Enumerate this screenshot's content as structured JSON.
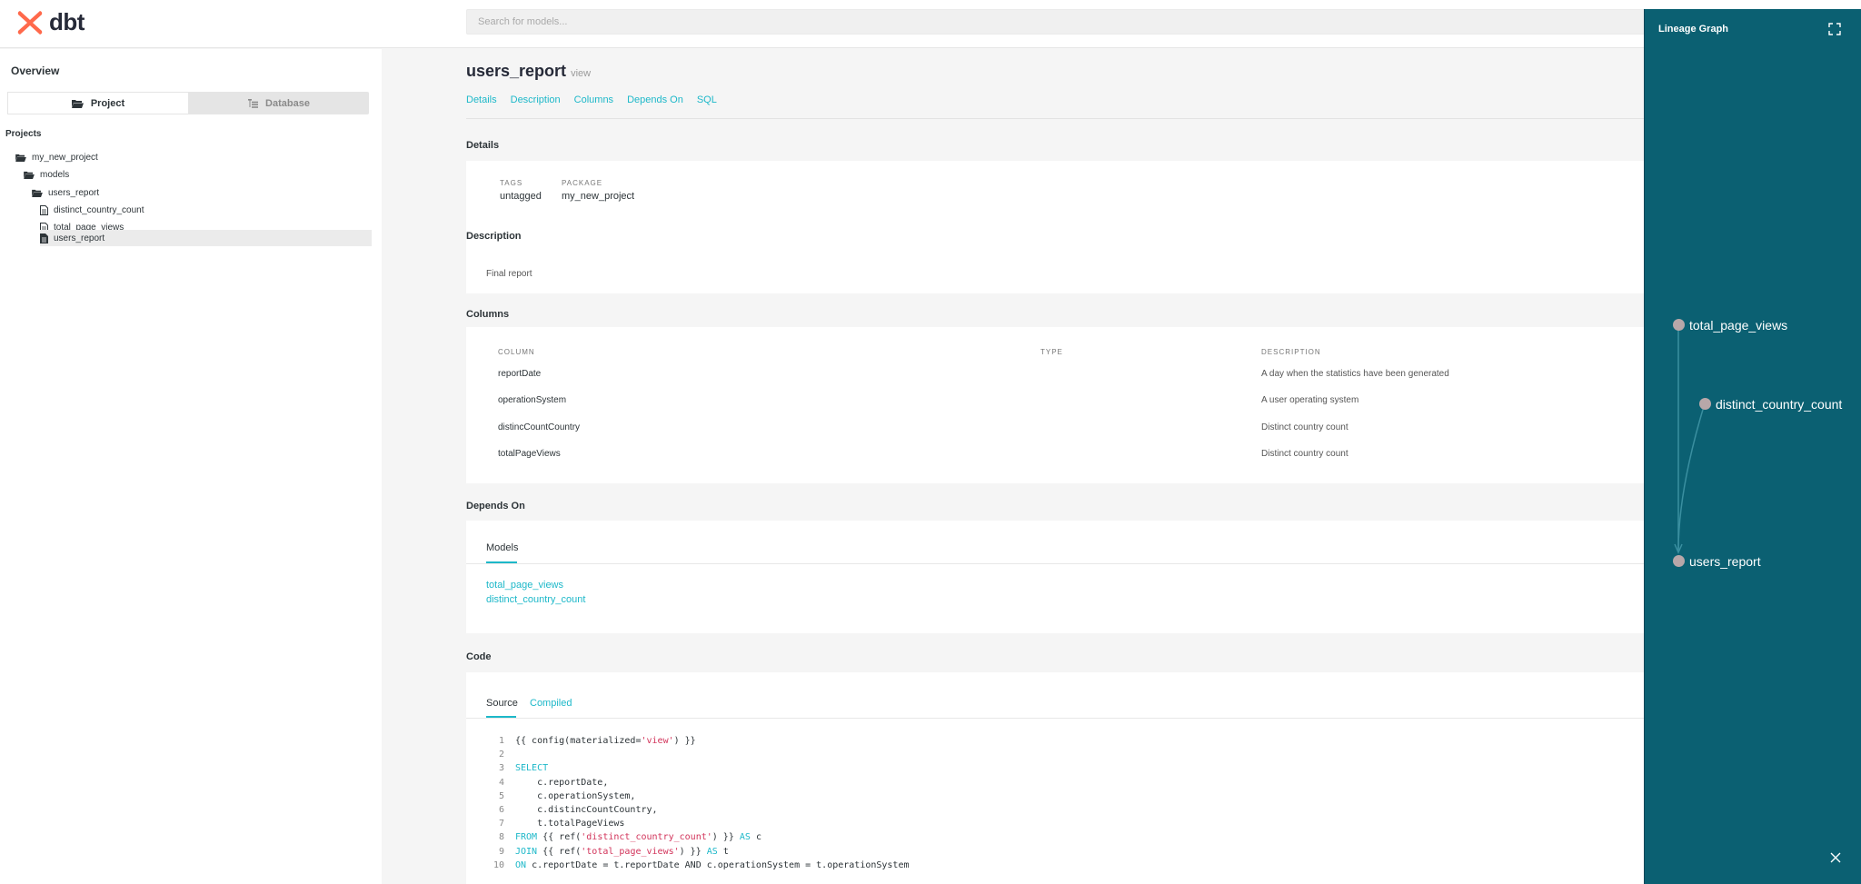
{
  "header": {
    "logo_text": "dbt",
    "search_placeholder": "Search for models..."
  },
  "sidebar": {
    "overview_label": "Overview",
    "switcher": {
      "project_label": "Project",
      "database_label": "Database",
      "active": "Project"
    },
    "projects_label": "Projects",
    "tree": [
      {
        "label": "my_new_project",
        "type": "folder-open"
      },
      {
        "label": "models",
        "type": "folder-open"
      },
      {
        "label": "users_report",
        "type": "folder-open"
      },
      {
        "label": "distinct_country_count",
        "type": "file"
      },
      {
        "label": "total_page_views",
        "type": "file"
      },
      {
        "label": "users_report",
        "type": "file",
        "selected": true
      }
    ]
  },
  "model": {
    "name": "users_report",
    "type": "view",
    "tabs": [
      "Details",
      "Description",
      "Columns",
      "Depends On",
      "SQL"
    ]
  },
  "details": {
    "title": "Details",
    "tags_label": "TAGS",
    "tags_value": "untagged",
    "package_label": "PACKAGE",
    "package_value": "my_new_project"
  },
  "description": {
    "title": "Description",
    "text": "Final report"
  },
  "columns": {
    "title": "Columns",
    "headers": [
      "COLUMN",
      "TYPE",
      "DESCRIPTION"
    ],
    "rows": [
      {
        "name": "reportDate",
        "type": "",
        "description": "A day when the statistics have been generated"
      },
      {
        "name": "operationSystem",
        "type": "",
        "description": "A user operating system"
      },
      {
        "name": "distincCountCountry",
        "type": "",
        "description": "Distinct country count"
      },
      {
        "name": "totalPageViews",
        "type": "",
        "description": "Distinct country count"
      }
    ]
  },
  "depends_on": {
    "title": "Depends On",
    "tab_label": "Models",
    "models": [
      "total_page_views",
      "distinct_country_count"
    ]
  },
  "code": {
    "title": "Code",
    "tabs": {
      "source": "Source",
      "compiled": "Compiled",
      "active": "Source"
    },
    "lines": [
      {
        "n": "1",
        "parts": [
          {
            "t": "{{ config(materialized=",
            "c": ""
          },
          {
            "t": "'view'",
            "c": "str"
          },
          {
            "t": ") }}",
            "c": ""
          }
        ]
      },
      {
        "n": "2",
        "parts": []
      },
      {
        "n": "3",
        "parts": [
          {
            "t": "SELECT",
            "c": "kw"
          }
        ]
      },
      {
        "n": "4",
        "parts": [
          {
            "t": "    c.reportDate,",
            "c": ""
          }
        ]
      },
      {
        "n": "5",
        "parts": [
          {
            "t": "    c.operationSystem,",
            "c": ""
          }
        ]
      },
      {
        "n": "6",
        "parts": [
          {
            "t": "    c.distincCountCountry,",
            "c": ""
          }
        ]
      },
      {
        "n": "7",
        "parts": [
          {
            "t": "    t.totalPageViews",
            "c": ""
          }
        ]
      },
      {
        "n": "8",
        "parts": [
          {
            "t": "FROM",
            "c": "kw"
          },
          {
            "t": " {{ ref(",
            "c": ""
          },
          {
            "t": "'distinct_country_count'",
            "c": "str"
          },
          {
            "t": ") }} ",
            "c": ""
          },
          {
            "t": "AS",
            "c": "kw"
          },
          {
            "t": " c",
            "c": ""
          }
        ]
      },
      {
        "n": "9",
        "parts": [
          {
            "t": "JOIN",
            "c": "kw"
          },
          {
            "t": " {{ ref(",
            "c": ""
          },
          {
            "t": "'total_page_views'",
            "c": "str"
          },
          {
            "t": ") }} ",
            "c": ""
          },
          {
            "t": "AS",
            "c": "kw"
          },
          {
            "t": " t",
            "c": ""
          }
        ]
      },
      {
        "n": "10",
        "parts": [
          {
            "t": "ON",
            "c": "kw"
          },
          {
            "t": " c.reportDate = t.reportDate ",
            "c": ""
          },
          {
            "t": "AND",
            "c": ""
          },
          {
            "t": " c.operationSystem = t.operationSystem",
            "c": ""
          }
        ]
      }
    ]
  },
  "lineage": {
    "title": "Lineage Graph",
    "nodes": [
      "total_page_views",
      "distinct_country_count",
      "users_report"
    ],
    "expand_icon": "expand-icon",
    "close_icon": "close-icon"
  },
  "colors": {
    "accent": "#1db8c9",
    "brand": "#ff694b",
    "lineage_bg": "#0b6072",
    "node": "#b8a7a9",
    "string": "#d2335a"
  }
}
